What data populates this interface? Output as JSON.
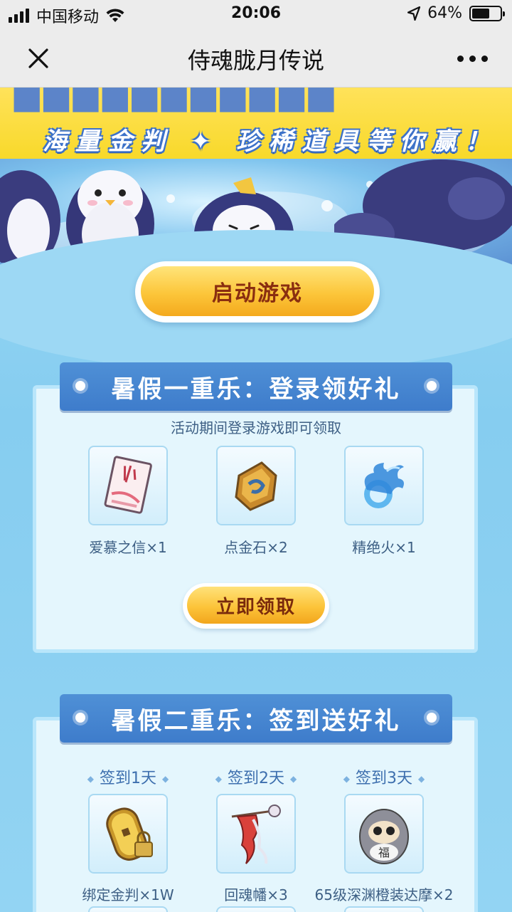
{
  "status_bar": {
    "carrier": "中国移动",
    "time": "20:06",
    "battery_text": "64%",
    "battery_level": 0.64
  },
  "nav": {
    "title": "侍魂胧月传说",
    "close_icon": "close-icon",
    "more_icon": "more-dots-icon"
  },
  "banner": {
    "subtitle": "海量金判 ✦ 珍稀道具等你赢！"
  },
  "start_button": {
    "label": "启动游戏"
  },
  "section1": {
    "title": "暑假一重乐：登录领好礼",
    "subtitle": "活动期间登录游戏即可领取",
    "items": [
      {
        "label": "爱慕之信×1",
        "icon": "love-letter-icon"
      },
      {
        "label": "点金石×2",
        "icon": "gold-stone-icon"
      },
      {
        "label": "精绝火×1",
        "icon": "blue-flame-icon"
      }
    ],
    "claim_label": "立即领取"
  },
  "section2": {
    "title": "暑假二重乐：签到送好礼",
    "days": [
      {
        "day": "签到1天",
        "label": "绑定金判×1W",
        "icon": "locked-gold-coin-icon"
      },
      {
        "day": "签到2天",
        "label": "回魂幡×3",
        "icon": "soul-banner-icon"
      },
      {
        "day": "签到3天",
        "label": "65级深渊橙装达摩×2",
        "icon": "daruma-icon"
      }
    ]
  },
  "colors": {
    "header_blue": "#4a89d3",
    "button_gold": "#fcc43a",
    "button_text": "#8a2e10",
    "banner_yellow": "#f8d92a"
  }
}
